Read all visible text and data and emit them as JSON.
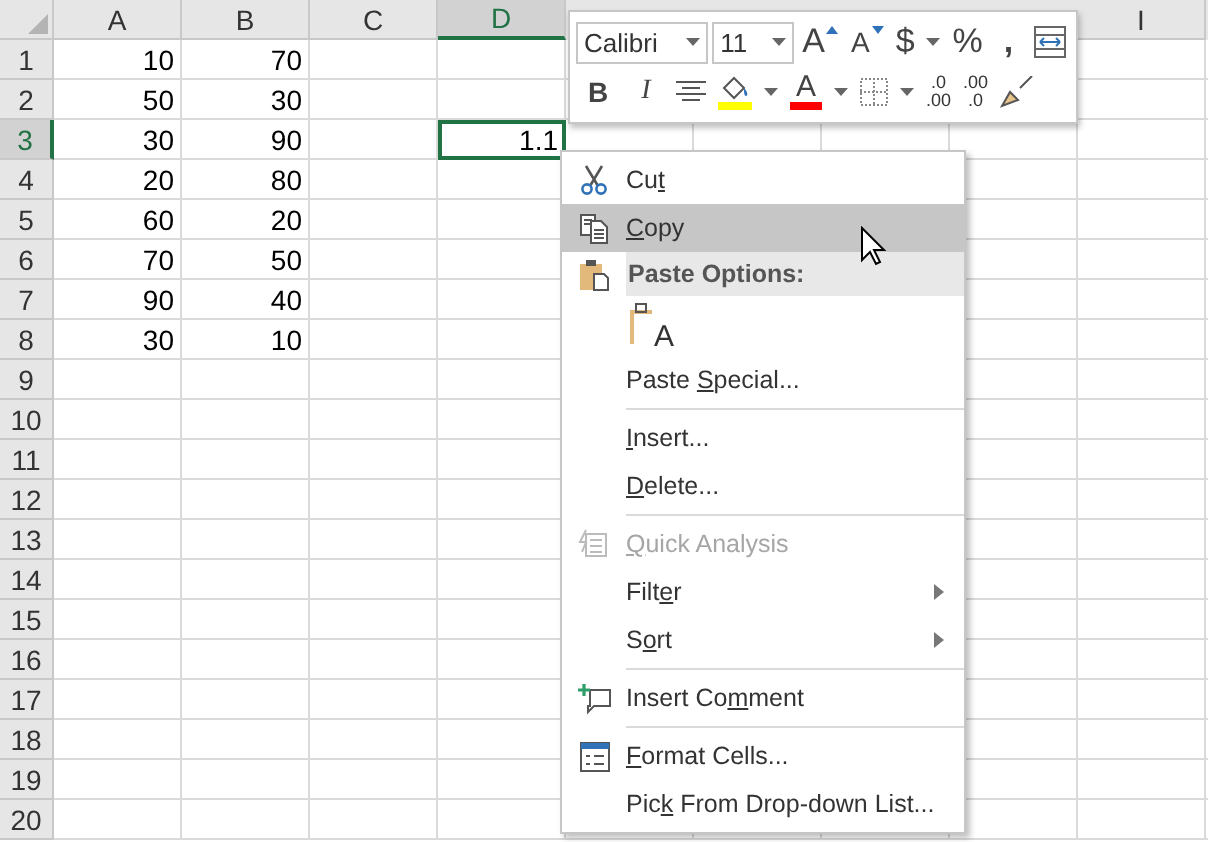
{
  "columns": [
    {
      "label": "A",
      "selected": false
    },
    {
      "label": "B",
      "selected": false
    },
    {
      "label": "C",
      "selected": false
    },
    {
      "label": "D",
      "selected": true
    },
    {},
    {},
    {},
    {},
    {
      "label": "I",
      "selected": false
    }
  ],
  "rows": [
    {
      "label": "1",
      "selected": false,
      "cells": [
        {
          "text": "10"
        },
        {
          "text": "70"
        }
      ]
    },
    {
      "label": "2",
      "selected": false,
      "cells": [
        {
          "text": "50"
        },
        {
          "text": "30"
        }
      ]
    },
    {
      "label": "3",
      "selected": true,
      "cells": [
        {
          "text": "30"
        },
        {
          "text": "90"
        },
        {},
        {
          "text": "1.1",
          "active": true
        }
      ]
    },
    {
      "label": "4",
      "selected": false,
      "cells": [
        {
          "text": "20"
        },
        {
          "text": "80"
        }
      ]
    },
    {
      "label": "5",
      "selected": false,
      "cells": [
        {
          "text": "60"
        },
        {
          "text": "20"
        }
      ]
    },
    {
      "label": "6",
      "selected": false,
      "cells": [
        {
          "text": "70"
        },
        {
          "text": "50"
        }
      ]
    },
    {
      "label": "7",
      "selected": false,
      "cells": [
        {
          "text": "90"
        },
        {
          "text": "40"
        }
      ]
    },
    {
      "label": "8",
      "selected": false,
      "cells": [
        {
          "text": "30"
        },
        {
          "text": "10"
        }
      ]
    },
    {
      "label": "9",
      "selected": false
    },
    {
      "label": "10",
      "selected": false
    },
    {
      "label": "11",
      "selected": false
    },
    {
      "label": "12",
      "selected": false
    },
    {
      "label": "13",
      "selected": false
    },
    {
      "label": "14",
      "selected": false
    },
    {
      "label": "15",
      "selected": false
    },
    {
      "label": "16",
      "selected": false
    },
    {
      "label": "17",
      "selected": false
    },
    {
      "label": "18",
      "selected": false
    },
    {
      "label": "19",
      "selected": false
    },
    {
      "label": "20",
      "selected": false
    }
  ],
  "mini_toolbar": {
    "font": "Calibri",
    "size": "11",
    "grow_font": "A",
    "shrink_font": "A",
    "currency": "$",
    "percent": "%",
    "comma": ",",
    "bold": "B",
    "italic": "I",
    "font_color": "A",
    "decrease_decimal": {
      "top": ".0",
      "bottom": ".00"
    },
    "increase_decimal": {
      "top": ".00",
      "bottom": ".0"
    }
  },
  "context_menu": [
    {
      "kind": "item",
      "label": [
        {
          "text": "Cu",
          "underline": false
        },
        {
          "text": "t",
          "underline": true
        }
      ],
      "selected": false,
      "disabled": false,
      "submenu": false
    },
    {
      "kind": "item",
      "label": [
        {
          "text": "C",
          "underline": true
        },
        {
          "text": "opy",
          "underline": false
        }
      ],
      "selected": true,
      "disabled": false,
      "submenu": false
    },
    {
      "kind": "header",
      "text": "Paste Options:"
    },
    {
      "kind": "paste_options",
      "letter": "A"
    },
    {
      "kind": "item",
      "label": [
        {
          "text": "Paste ",
          "underline": false
        },
        {
          "text": "S",
          "underline": true
        },
        {
          "text": "pecial...",
          "underline": false
        }
      ],
      "selected": false,
      "disabled": false,
      "submenu": false
    },
    {
      "kind": "separator"
    },
    {
      "kind": "item",
      "label": [
        {
          "text": "I",
          "underline": true
        },
        {
          "text": "nsert...",
          "underline": false
        }
      ],
      "selected": false,
      "disabled": false,
      "submenu": false
    },
    {
      "kind": "item",
      "label": [
        {
          "text": "D",
          "underline": true
        },
        {
          "text": "elete...",
          "underline": false
        }
      ],
      "selected": false,
      "disabled": false,
      "submenu": false
    },
    {
      "kind": "separator"
    },
    {
      "kind": "item",
      "label": [
        {
          "text": "Q",
          "underline": true
        },
        {
          "text": "uick Analysis",
          "underline": false
        }
      ],
      "selected": false,
      "disabled": true,
      "submenu": false
    },
    {
      "kind": "item",
      "label": [
        {
          "text": "Filt",
          "underline": false
        },
        {
          "text": "e",
          "underline": true
        },
        {
          "text": "r",
          "underline": false
        }
      ],
      "selected": false,
      "disabled": false,
      "submenu": true
    },
    {
      "kind": "item",
      "label": [
        {
          "text": "S",
          "underline": false
        },
        {
          "text": "o",
          "underline": true
        },
        {
          "text": "rt",
          "underline": false
        }
      ],
      "selected": false,
      "disabled": false,
      "submenu": true
    },
    {
      "kind": "separator"
    },
    {
      "kind": "item",
      "label": [
        {
          "text": "Insert Co",
          "underline": false
        },
        {
          "text": "m",
          "underline": true
        },
        {
          "text": "ment",
          "underline": false
        }
      ],
      "selected": false,
      "disabled": false,
      "submenu": false
    },
    {
      "kind": "separator"
    },
    {
      "kind": "item",
      "label": [
        {
          "text": "F",
          "underline": true
        },
        {
          "text": "ormat Cells...",
          "underline": false
        }
      ],
      "selected": false,
      "disabled": false,
      "submenu": false
    },
    {
      "kind": "item",
      "label": [
        {
          "text": "Pic",
          "underline": false
        },
        {
          "text": "k",
          "underline": true
        },
        {
          "text": " From Drop-down List...",
          "underline": false
        }
      ],
      "selected": false,
      "disabled": false,
      "submenu": false
    }
  ]
}
